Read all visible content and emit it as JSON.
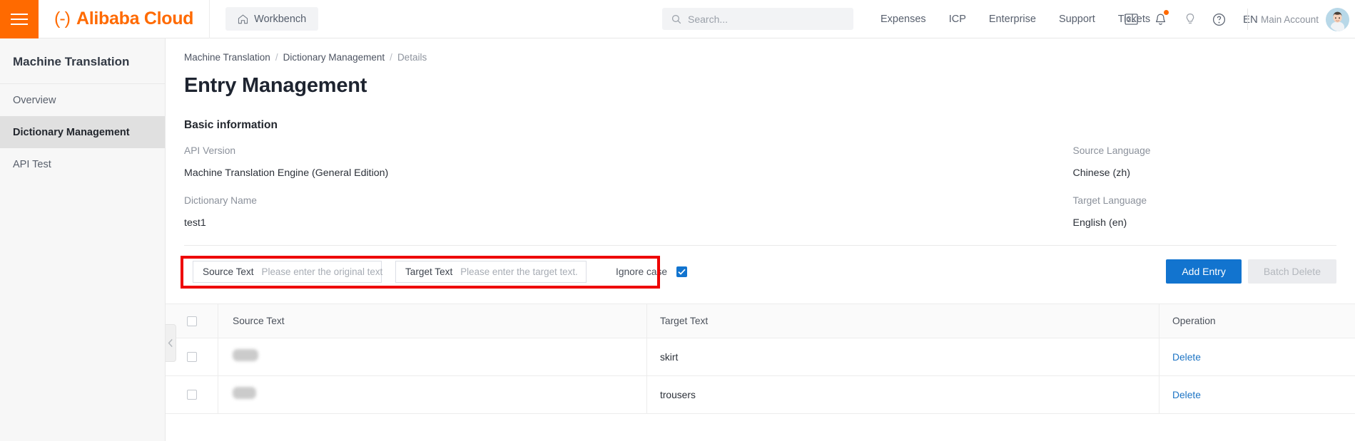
{
  "topbar": {
    "hamburger_icon": "hamburger-menu-icon",
    "brand_mark": "(-)",
    "brand": "Alibaba Cloud",
    "workbench": "Workbench",
    "home_icon": "home-icon",
    "search_placeholder": "Search...",
    "search_value": "",
    "search_icon": "search-icon",
    "nav_links": [
      "Expenses",
      "ICP",
      "Enterprise",
      "Support",
      "Tickets"
    ],
    "icons": [
      {
        "name": "console-terminal-icon",
        "badge": false
      },
      {
        "name": "bell-notification-icon",
        "badge": true
      },
      {
        "name": "lightbulb-idea-icon",
        "badge": false
      },
      {
        "name": "help-question-icon",
        "badge": false
      }
    ],
    "language": "EN",
    "account_name": "Main Account",
    "avatar_icon": "user-avatar"
  },
  "sidebar": {
    "title": "Machine Translation",
    "items": [
      {
        "label": "Overview",
        "active": false
      },
      {
        "label": "Dictionary Management",
        "active": true
      },
      {
        "label": "API Test",
        "active": false
      }
    ],
    "collapse_icon": "chevron-left-icon"
  },
  "main": {
    "breadcrumb": [
      "Machine Translation",
      "Dictionary Management",
      "Details"
    ],
    "breadcrumb_separator": "/",
    "page_title": "Entry Management",
    "section_title": "Basic information",
    "info": [
      {
        "left_label": "API Version",
        "left_value": "Machine Translation Engine (General Edition)",
        "right_label": "Source Language",
        "right_value": "Chinese (zh)"
      },
      {
        "left_label": "Dictionary Name",
        "left_value": "test1",
        "right_label": "Target Language",
        "right_value": "English (en)"
      }
    ],
    "filter": {
      "source_label": "Source Text",
      "source_placeholder": "Please enter the original text",
      "source_value": "",
      "target_label": "Target Text",
      "target_placeholder": "Please enter the target text.",
      "target_value": "",
      "ignore_case_label": "Ignore case",
      "ignore_case_checked": true,
      "highlight_color": "#ee0000"
    },
    "actions": {
      "add_entry": "Add Entry",
      "batch_delete": "Batch Delete",
      "primary_color": "#1274cf"
    },
    "table": {
      "columns": [
        "Source Text",
        "Target Text",
        "Operation"
      ],
      "rows": [
        {
          "source": "",
          "source_redacted": true,
          "target": "skirt",
          "operation": "Delete"
        },
        {
          "source": "",
          "source_redacted": true,
          "target": "trousers",
          "operation": "Delete"
        }
      ]
    }
  }
}
